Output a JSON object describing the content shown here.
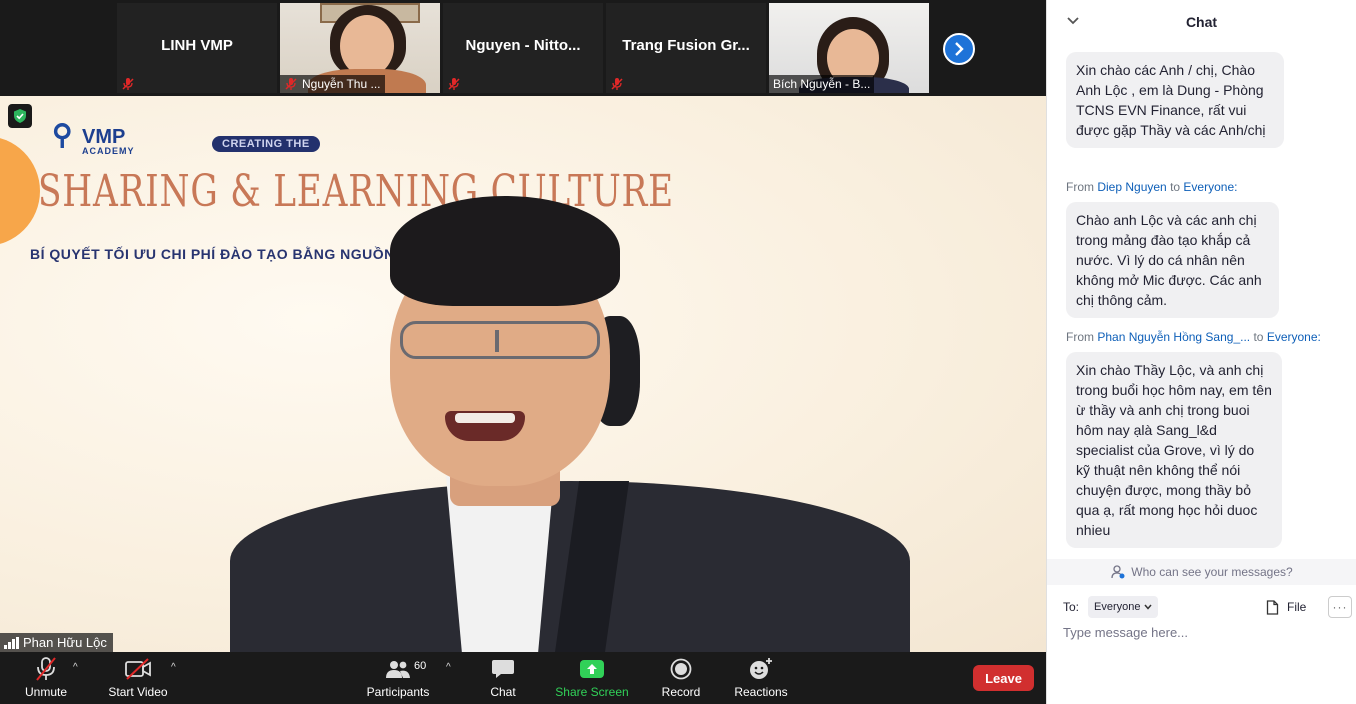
{
  "gallery": {
    "tiles": [
      {
        "name": "LINH VMP",
        "type": "name-only"
      },
      {
        "name": "Nguyễn Thu ...",
        "type": "video"
      },
      {
        "name": "Nguyen - Nitto...",
        "type": "name-only"
      },
      {
        "name": "Trang Fusion Gr...",
        "type": "name-only"
      },
      {
        "name": "Bích Nguyễn - B...",
        "type": "video"
      }
    ],
    "next_icon": "chevron-right-icon"
  },
  "main": {
    "speaker_name": "Phan Hữu Lộc",
    "slide": {
      "logo_text": "VMP",
      "logo_sub": "ACADEMY",
      "pill": "CREATING THE",
      "title": "SHARING & LEARNING CULTURE",
      "subtitle": "BÍ QUYẾT TỐI ƯU CHI PHÍ ĐÀO TẠO BẰNG NGUỒN"
    }
  },
  "toolbar": {
    "unmute": "Unmute",
    "start_video": "Start Video",
    "participants": "Participants",
    "participants_count": "60",
    "chat": "Chat",
    "share_screen": "Share Screen",
    "record": "Record",
    "reactions": "Reactions",
    "leave": "Leave"
  },
  "chat": {
    "title": "Chat",
    "messages": [
      {
        "text": "Xin chào các Anh / chị, Chào Anh Lộc , em là Dung - Phòng TCNS EVN Finance, rất vui được gặp Thầy và các Anh/chị"
      },
      {
        "from_prefix": "From",
        "from": "Diep Nguyen",
        "to_prefix": "to",
        "to": "Everyone:",
        "text": "Chào anh Lộc và các anh chị trong mảng đào tạo khắp cả nước. Vì lý do cá nhân nên không mở Mic được. Các anh chị thông cảm."
      },
      {
        "from_prefix": "From",
        "from": "Phan Nguyễn Hồng Sang_...",
        "to_prefix": "to",
        "to": "Everyone:",
        "text": "Xin chào Thầy Lộc, và anh chị trong buổi học hôm nay, em tên ừ thầy và anh chị trong buoi hôm nay ạlà Sang_l&d specialist của Grove, vì lý do kỹ thuật nên không thể nói chuyện được, mong thầy bỏ qua ạ, rất mong học hỏi duoc nhieu"
      }
    ],
    "privacy_text": "Who can see your messages?",
    "to_label": "To:",
    "to_value": "Everyone",
    "file_label": "File",
    "input_placeholder": "Type message here..."
  },
  "colors": {
    "leave": "#d12f2f",
    "share_screen": "#31d158",
    "link_blue": "#0e5fb8",
    "next_button": "#1e73d8"
  }
}
